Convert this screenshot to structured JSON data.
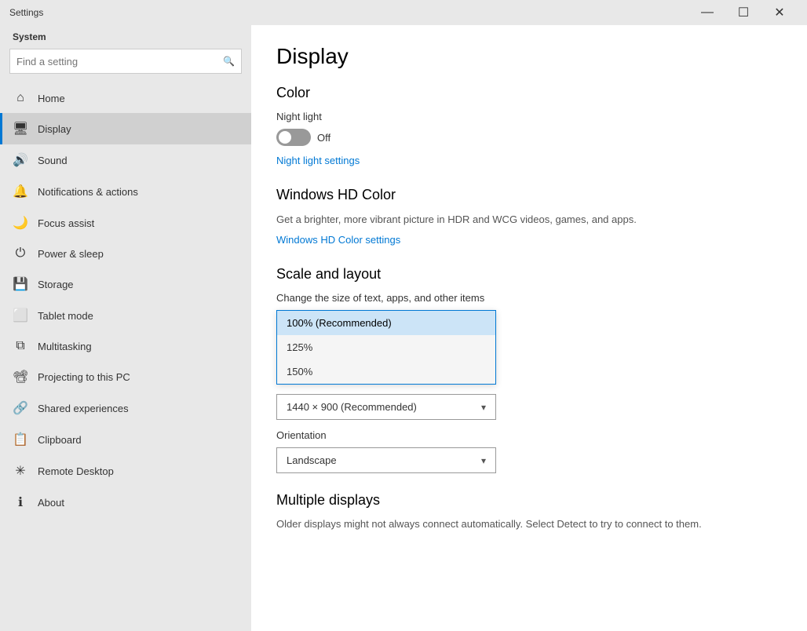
{
  "titlebar": {
    "title": "Settings",
    "minimize": "—",
    "maximize": "☐",
    "close": "✕"
  },
  "sidebar": {
    "header": "System",
    "search_placeholder": "Find a setting",
    "items": [
      {
        "id": "home",
        "label": "Home",
        "icon": "⌂"
      },
      {
        "id": "display",
        "label": "Display",
        "icon": "🖥",
        "active": true
      },
      {
        "id": "sound",
        "label": "Sound",
        "icon": "🔊"
      },
      {
        "id": "notifications",
        "label": "Notifications & actions",
        "icon": "🔔"
      },
      {
        "id": "focus",
        "label": "Focus assist",
        "icon": "🌙"
      },
      {
        "id": "power",
        "label": "Power & sleep",
        "icon": "⏻"
      },
      {
        "id": "storage",
        "label": "Storage",
        "icon": "💾"
      },
      {
        "id": "tablet",
        "label": "Tablet mode",
        "icon": "⬜"
      },
      {
        "id": "multitasking",
        "label": "Multitasking",
        "icon": "⧉"
      },
      {
        "id": "projecting",
        "label": "Projecting to this PC",
        "icon": "📽"
      },
      {
        "id": "shared",
        "label": "Shared experiences",
        "icon": "🔗"
      },
      {
        "id": "clipboard",
        "label": "Clipboard",
        "icon": "📋"
      },
      {
        "id": "remote",
        "label": "Remote Desktop",
        "icon": "✳"
      },
      {
        "id": "about",
        "label": "About",
        "icon": "ℹ"
      }
    ]
  },
  "main": {
    "page_title": "Display",
    "color_section": {
      "title": "Color",
      "night_light_label": "Night light",
      "night_light_status": "Off",
      "night_light_link": "Night light settings"
    },
    "hd_color_section": {
      "title": "Windows HD Color",
      "description": "Get a brighter, more vibrant picture in HDR and WCG videos, games, and apps.",
      "link": "Windows HD Color settings"
    },
    "scale_section": {
      "title": "Scale and layout",
      "change_size_label": "Change the size of text, apps, and other items",
      "options": [
        {
          "value": "100% (Recommended)",
          "selected": true
        },
        {
          "value": "125%",
          "selected": false
        },
        {
          "value": "150%",
          "selected": false
        }
      ],
      "resolution_value": "1440 × 900 (Recommended)",
      "orientation_label": "Orientation",
      "orientation_value": "Landscape"
    },
    "multiple_displays": {
      "title": "Multiple displays",
      "description": "Older displays might not always connect automatically. Select Detect to try to connect to them."
    }
  }
}
